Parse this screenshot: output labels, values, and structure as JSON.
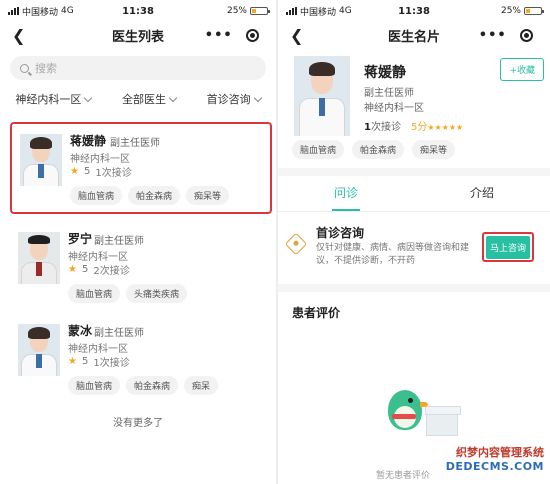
{
  "status": {
    "carrier": "中国移动",
    "network": "4G",
    "time": "11:38",
    "battery": "25%"
  },
  "list_page": {
    "title": "医生列表",
    "search_placeholder": "搜索",
    "filters": [
      "神经内科一区",
      "全部医生",
      "首诊咨询"
    ],
    "doctors": [
      {
        "name": "蒋媛静",
        "title": "副主任医师",
        "dept": "神经内科一区",
        "rating": "5",
        "consults": "1次接诊",
        "tags": [
          "脑血管病",
          "帕金森病",
          "痴呆等"
        ],
        "selected": true
      },
      {
        "name": "罗宁",
        "title": "副主任医师",
        "dept": "神经内科一区",
        "rating": "5",
        "consults": "2次接诊",
        "tags": [
          "脑血管病",
          "头痛类疾病"
        ],
        "selected": false
      },
      {
        "name": "蒙冰",
        "title": "副主任医师",
        "dept": "神经内科一区",
        "rating": "5",
        "consults": "1次接诊",
        "tags": [
          "脑血管病",
          "帕金森病",
          "痴呆"
        ],
        "selected": false
      }
    ],
    "no_more": "没有更多了"
  },
  "card_page": {
    "title": "医生名片",
    "name": "蒋媛静",
    "doc_title": "副主任医师",
    "dept": "神经内科一区",
    "consults_count": "1",
    "consults_label": "次接诊",
    "score": "5分",
    "stars": "★★★★★",
    "follow_label": "+收藏",
    "tags": [
      "脑血管病",
      "帕金森病",
      "痴呆等"
    ],
    "tabs": [
      "问诊",
      "介绍"
    ],
    "consult": {
      "title": "首诊咨询",
      "desc": "仅针对健康、病情、病因等做咨询和建议，不提供诊断，不开药",
      "button": "马上咨询"
    },
    "reviews_title": "患者评价",
    "empty_hint": "暂无患者评价"
  },
  "watermark": {
    "line1": "织梦内容管理系统",
    "line2": "DEDECMS.COM"
  }
}
